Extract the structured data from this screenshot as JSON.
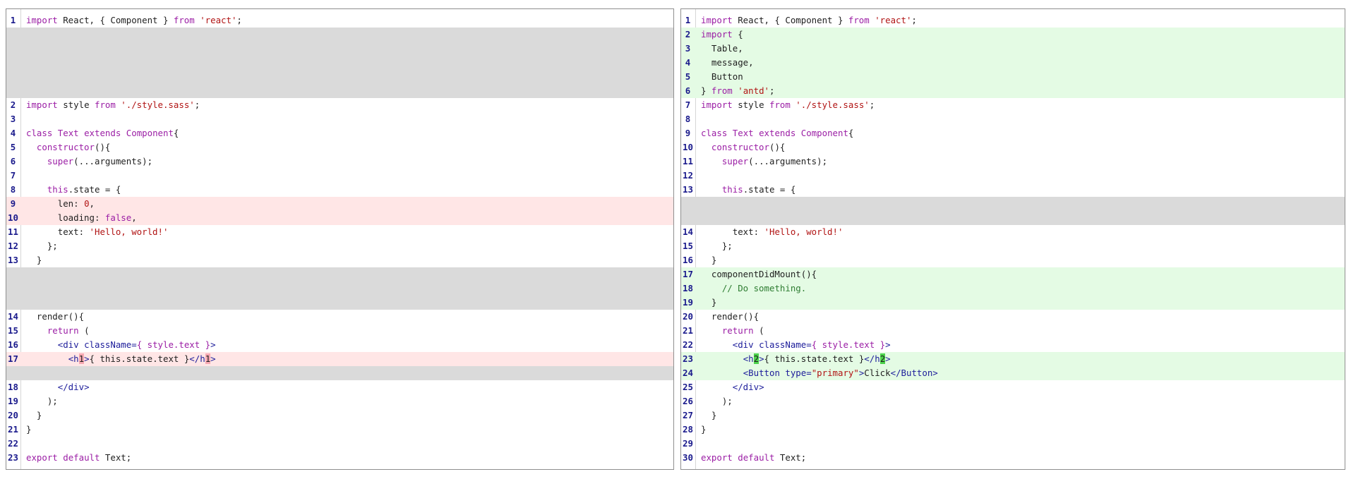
{
  "left_pane": {
    "rows": [
      {
        "n": "1",
        "type": "ctx",
        "tokens": [
          {
            "t": "import",
            "c": "kw"
          },
          {
            "t": " React, { Component } "
          },
          {
            "t": "from",
            "c": "kw"
          },
          {
            "t": " "
          },
          {
            "t": "'react'",
            "c": "str"
          },
          {
            "t": ";"
          }
        ]
      },
      {
        "n": "",
        "type": "filler",
        "tokens": []
      },
      {
        "n": "",
        "type": "filler",
        "tokens": []
      },
      {
        "n": "",
        "type": "filler",
        "tokens": []
      },
      {
        "n": "",
        "type": "filler",
        "tokens": []
      },
      {
        "n": "",
        "type": "filler",
        "tokens": []
      },
      {
        "n": "2",
        "type": "ctx",
        "tokens": [
          {
            "t": "import",
            "c": "kw"
          },
          {
            "t": " style "
          },
          {
            "t": "from",
            "c": "kw"
          },
          {
            "t": " "
          },
          {
            "t": "'./style.sass'",
            "c": "str"
          },
          {
            "t": ";"
          }
        ]
      },
      {
        "n": "3",
        "type": "ctx",
        "tokens": []
      },
      {
        "n": "4",
        "type": "ctx",
        "tokens": [
          {
            "t": "class",
            "c": "kw"
          },
          {
            "t": " "
          },
          {
            "t": "Text",
            "c": "kw"
          },
          {
            "t": " "
          },
          {
            "t": "extends",
            "c": "kw"
          },
          {
            "t": " "
          },
          {
            "t": "Component",
            "c": "kw"
          },
          {
            "t": "{"
          }
        ]
      },
      {
        "n": "5",
        "type": "ctx",
        "tokens": [
          {
            "t": "  "
          },
          {
            "t": "constructor",
            "c": "kw"
          },
          {
            "t": "(){"
          }
        ]
      },
      {
        "n": "6",
        "type": "ctx",
        "tokens": [
          {
            "t": "    "
          },
          {
            "t": "super",
            "c": "kw"
          },
          {
            "t": "(...arguments);"
          }
        ]
      },
      {
        "n": "7",
        "type": "ctx",
        "tokens": []
      },
      {
        "n": "8",
        "type": "ctx",
        "tokens": [
          {
            "t": "    "
          },
          {
            "t": "this",
            "c": "kw"
          },
          {
            "t": ".state = {"
          }
        ]
      },
      {
        "n": "9",
        "type": "del",
        "tokens": [
          {
            "t": "      len: "
          },
          {
            "t": "0",
            "c": "str"
          },
          {
            "t": ","
          }
        ]
      },
      {
        "n": "10",
        "type": "del",
        "tokens": [
          {
            "t": "      loading: "
          },
          {
            "t": "false",
            "c": "kw"
          },
          {
            "t": ","
          }
        ]
      },
      {
        "n": "11",
        "type": "ctx",
        "tokens": [
          {
            "t": "      text: "
          },
          {
            "t": "'Hello, world!'",
            "c": "str"
          }
        ]
      },
      {
        "n": "12",
        "type": "ctx",
        "tokens": [
          {
            "t": "    };"
          }
        ]
      },
      {
        "n": "13",
        "type": "ctx",
        "tokens": [
          {
            "t": "  }"
          }
        ]
      },
      {
        "n": "",
        "type": "filler",
        "tokens": []
      },
      {
        "n": "",
        "type": "filler",
        "tokens": []
      },
      {
        "n": "",
        "type": "filler",
        "tokens": []
      },
      {
        "n": "14",
        "type": "ctx",
        "tokens": [
          {
            "t": "  render(){"
          }
        ]
      },
      {
        "n": "15",
        "type": "ctx",
        "tokens": [
          {
            "t": "    "
          },
          {
            "t": "return",
            "c": "kw"
          },
          {
            "t": " ("
          }
        ]
      },
      {
        "n": "16",
        "type": "ctx",
        "tokens": [
          {
            "t": "      "
          },
          {
            "t": "<div ",
            "c": "tag"
          },
          {
            "t": "className=",
            "c": "attr"
          },
          {
            "t": "{ style.text }",
            "c": "kw"
          },
          {
            "t": ">",
            "c": "tag"
          }
        ]
      },
      {
        "n": "17",
        "type": "del",
        "tokens": [
          {
            "t": "        "
          },
          {
            "t": "<h",
            "c": "tag"
          },
          {
            "t": "1",
            "c": "hl-del"
          },
          {
            "t": ">",
            "c": "tag"
          },
          {
            "t": "{ this.state.text }"
          },
          {
            "t": "</h",
            "c": "tag"
          },
          {
            "t": "1",
            "c": "hl-del"
          },
          {
            "t": ">",
            "c": "tag"
          }
        ]
      },
      {
        "n": "",
        "type": "filler",
        "tokens": []
      },
      {
        "n": "18",
        "type": "ctx",
        "tokens": [
          {
            "t": "      "
          },
          {
            "t": "</div>",
            "c": "tag"
          }
        ]
      },
      {
        "n": "19",
        "type": "ctx",
        "tokens": [
          {
            "t": "    );"
          }
        ]
      },
      {
        "n": "20",
        "type": "ctx",
        "tokens": [
          {
            "t": "  }"
          }
        ]
      },
      {
        "n": "21",
        "type": "ctx",
        "tokens": [
          {
            "t": "}"
          }
        ]
      },
      {
        "n": "22",
        "type": "ctx",
        "tokens": []
      },
      {
        "n": "23",
        "type": "ctx",
        "tokens": [
          {
            "t": "export",
            "c": "kw"
          },
          {
            "t": " "
          },
          {
            "t": "default",
            "c": "kw"
          },
          {
            "t": " Text;"
          }
        ]
      }
    ]
  },
  "right_pane": {
    "rows": [
      {
        "n": "1",
        "type": "ctx",
        "tokens": [
          {
            "t": "import",
            "c": "kw"
          },
          {
            "t": " React, { Component } "
          },
          {
            "t": "from",
            "c": "kw"
          },
          {
            "t": " "
          },
          {
            "t": "'react'",
            "c": "str"
          },
          {
            "t": ";"
          }
        ]
      },
      {
        "n": "2",
        "type": "add",
        "tokens": [
          {
            "t": "import",
            "c": "kw"
          },
          {
            "t": " {"
          }
        ]
      },
      {
        "n": "3",
        "type": "add",
        "tokens": [
          {
            "t": "  Table,"
          }
        ]
      },
      {
        "n": "4",
        "type": "add",
        "tokens": [
          {
            "t": "  message,"
          }
        ]
      },
      {
        "n": "5",
        "type": "add",
        "tokens": [
          {
            "t": "  Button"
          }
        ]
      },
      {
        "n": "6",
        "type": "add",
        "tokens": [
          {
            "t": "} "
          },
          {
            "t": "from",
            "c": "kw"
          },
          {
            "t": " "
          },
          {
            "t": "'antd'",
            "c": "str"
          },
          {
            "t": ";"
          }
        ]
      },
      {
        "n": "7",
        "type": "ctx",
        "tokens": [
          {
            "t": "import",
            "c": "kw"
          },
          {
            "t": " style "
          },
          {
            "t": "from",
            "c": "kw"
          },
          {
            "t": " "
          },
          {
            "t": "'./style.sass'",
            "c": "str"
          },
          {
            "t": ";"
          }
        ]
      },
      {
        "n": "8",
        "type": "ctx",
        "tokens": []
      },
      {
        "n": "9",
        "type": "ctx",
        "tokens": [
          {
            "t": "class",
            "c": "kw"
          },
          {
            "t": " "
          },
          {
            "t": "Text",
            "c": "kw"
          },
          {
            "t": " "
          },
          {
            "t": "extends",
            "c": "kw"
          },
          {
            "t": " "
          },
          {
            "t": "Component",
            "c": "kw"
          },
          {
            "t": "{"
          }
        ]
      },
      {
        "n": "10",
        "type": "ctx",
        "tokens": [
          {
            "t": "  "
          },
          {
            "t": "constructor",
            "c": "kw"
          },
          {
            "t": "(){"
          }
        ]
      },
      {
        "n": "11",
        "type": "ctx",
        "tokens": [
          {
            "t": "    "
          },
          {
            "t": "super",
            "c": "kw"
          },
          {
            "t": "(...arguments);"
          }
        ]
      },
      {
        "n": "12",
        "type": "ctx",
        "tokens": []
      },
      {
        "n": "13",
        "type": "ctx",
        "tokens": [
          {
            "t": "    "
          },
          {
            "t": "this",
            "c": "kw"
          },
          {
            "t": ".state = {"
          }
        ]
      },
      {
        "n": "",
        "type": "filler",
        "tokens": []
      },
      {
        "n": "",
        "type": "filler",
        "tokens": []
      },
      {
        "n": "14",
        "type": "ctx",
        "tokens": [
          {
            "t": "      text: "
          },
          {
            "t": "'Hello, world!'",
            "c": "str"
          }
        ]
      },
      {
        "n": "15",
        "type": "ctx",
        "tokens": [
          {
            "t": "    };"
          }
        ]
      },
      {
        "n": "16",
        "type": "ctx",
        "tokens": [
          {
            "t": "  }"
          }
        ]
      },
      {
        "n": "17",
        "type": "add",
        "tokens": [
          {
            "t": "  componentDidMount(){"
          }
        ]
      },
      {
        "n": "18",
        "type": "add",
        "tokens": [
          {
            "t": "    "
          },
          {
            "t": "// Do something.",
            "c": "cmt"
          }
        ]
      },
      {
        "n": "19",
        "type": "add",
        "tokens": [
          {
            "t": "  }"
          }
        ]
      },
      {
        "n": "20",
        "type": "ctx",
        "tokens": [
          {
            "t": "  render(){"
          }
        ]
      },
      {
        "n": "21",
        "type": "ctx",
        "tokens": [
          {
            "t": "    "
          },
          {
            "t": "return",
            "c": "kw"
          },
          {
            "t": " ("
          }
        ]
      },
      {
        "n": "22",
        "type": "ctx",
        "tokens": [
          {
            "t": "      "
          },
          {
            "t": "<div ",
            "c": "tag"
          },
          {
            "t": "className=",
            "c": "attr"
          },
          {
            "t": "{ style.text }",
            "c": "kw"
          },
          {
            "t": ">",
            "c": "tag"
          }
        ]
      },
      {
        "n": "23",
        "type": "add",
        "tokens": [
          {
            "t": "        "
          },
          {
            "t": "<h",
            "c": "tag"
          },
          {
            "t": "2",
            "c": "hl-add"
          },
          {
            "t": ">",
            "c": "tag"
          },
          {
            "t": "{ this.state.text }"
          },
          {
            "t": "</h",
            "c": "tag"
          },
          {
            "t": "2",
            "c": "hl-add"
          },
          {
            "t": ">",
            "c": "tag"
          }
        ]
      },
      {
        "n": "24",
        "type": "add",
        "tokens": [
          {
            "t": "        "
          },
          {
            "t": "<Button ",
            "c": "tag"
          },
          {
            "t": "type=",
            "c": "attr"
          },
          {
            "t": "\"primary\"",
            "c": "str"
          },
          {
            "t": ">",
            "c": "tag"
          },
          {
            "t": "Click"
          },
          {
            "t": "</Button>",
            "c": "tag"
          }
        ]
      },
      {
        "n": "25",
        "type": "ctx",
        "tokens": [
          {
            "t": "      "
          },
          {
            "t": "</div>",
            "c": "tag"
          }
        ]
      },
      {
        "n": "26",
        "type": "ctx",
        "tokens": [
          {
            "t": "    );"
          }
        ]
      },
      {
        "n": "27",
        "type": "ctx",
        "tokens": [
          {
            "t": "  }"
          }
        ]
      },
      {
        "n": "28",
        "type": "ctx",
        "tokens": [
          {
            "t": "}"
          }
        ]
      },
      {
        "n": "29",
        "type": "ctx",
        "tokens": []
      },
      {
        "n": "30",
        "type": "ctx",
        "tokens": [
          {
            "t": "export",
            "c": "kw"
          },
          {
            "t": " "
          },
          {
            "t": "default",
            "c": "kw"
          },
          {
            "t": " Text;"
          }
        ]
      }
    ]
  },
  "colors": {
    "deleted_line_bg": "#ffe6e6",
    "added_line_bg": "#e4fbe4",
    "filler_bg": "#dadada",
    "deleted_char_highlight": "#f7a9b3",
    "added_char_highlight": "#4cd34c",
    "line_number": "#1a1a8c",
    "keyword": "#9b1ea5",
    "string": "#b11414"
  }
}
